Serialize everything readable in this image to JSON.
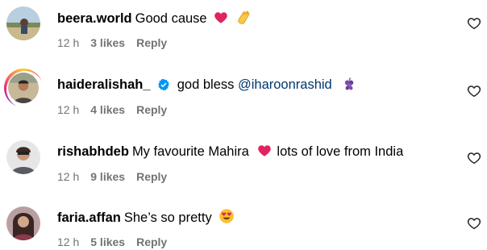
{
  "comments": [
    {
      "username": "beera.world",
      "text": "Good cause",
      "time": "12 h",
      "likes": "3 likes",
      "reply": "Reply",
      "emojis": [
        "red-heart-icon",
        "clapping-hands-icon"
      ]
    },
    {
      "username": "haideralishah_",
      "text": "god bless",
      "mention": "@iharoonrashid",
      "time": "12 h",
      "likes": "4 likes",
      "reply": "Reply",
      "verified": true,
      "emojis": [
        "grape-icon"
      ]
    },
    {
      "username": "rishabhdeb",
      "text": "My favourite Mahira",
      "text_after": "lots of love from India",
      "time": "12 h",
      "likes": "9 likes",
      "reply": "Reply",
      "emojis": [
        "red-heart-icon"
      ]
    },
    {
      "username": "faria.affan",
      "text": "She’s so pretty",
      "time": "12 h",
      "likes": "5 likes",
      "reply": "Reply",
      "emojis": [
        "heart-eyes-face-icon"
      ]
    }
  ],
  "colors": {
    "heart": "#e0245e",
    "verified": "#0095f6",
    "mention": "#00376b",
    "meta": "#737373"
  }
}
